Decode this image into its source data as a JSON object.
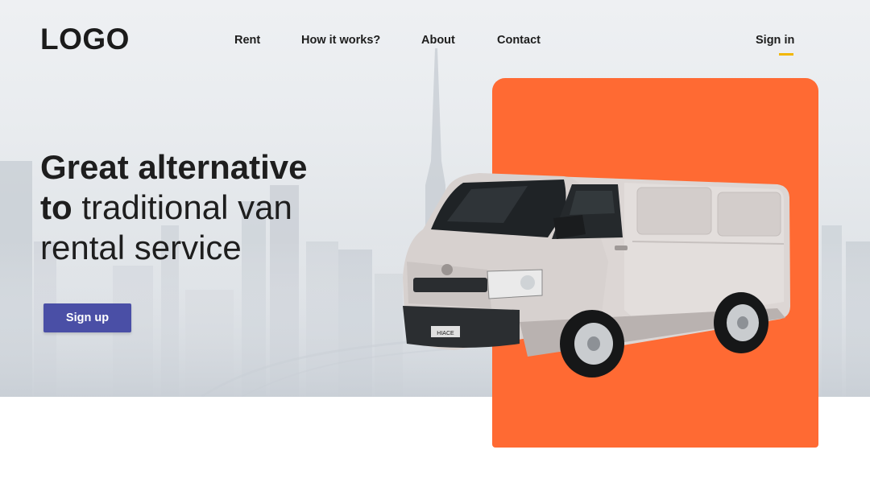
{
  "header": {
    "logo": "LOGO",
    "nav": [
      "Rent",
      "How it works?",
      "About",
      "Contact"
    ],
    "signin": "Sign in"
  },
  "hero": {
    "line1_bold": "Great alternative",
    "line2_bold": "to",
    "line2_rest": " traditional van",
    "line3": "rental service",
    "cta": "Sign up",
    "van_badge": "HIACE"
  },
  "colors": {
    "accent_orange": "#ff6a33",
    "button_blue": "#4a4fa6",
    "underline_yellow": "#f2b705"
  },
  "icons": {
    "van": "van-image",
    "skyline": "city-skyline-background"
  }
}
